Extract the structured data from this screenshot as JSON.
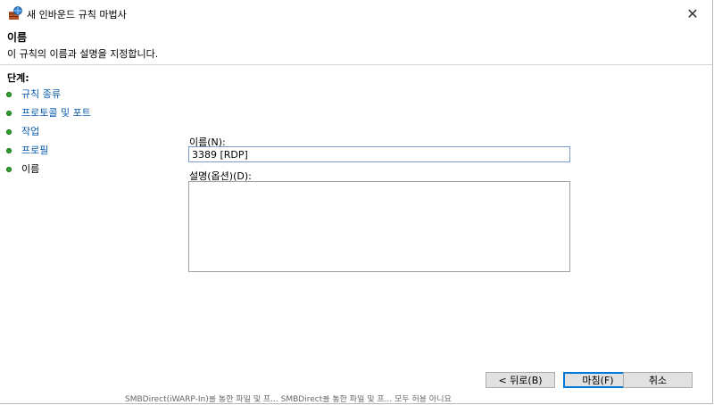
{
  "window": {
    "title": "새 인바운드 규칙 마법사",
    "close_symbol": "✕"
  },
  "header": {
    "title": "이름",
    "description": "이 규칙의 이름과 설명을 지정합니다."
  },
  "steps": {
    "title": "단계:",
    "items": [
      {
        "label": "규칙 종류"
      },
      {
        "label": "프로토콜 및 포트"
      },
      {
        "label": "작업"
      },
      {
        "label": "프로필"
      },
      {
        "label": "이름"
      }
    ]
  },
  "form": {
    "name_label": "이름(N):",
    "name_value": "3389 [RDP]",
    "description_label": "설명(옵션)(D):",
    "description_value": ""
  },
  "buttons": {
    "back": "< 뒤로(B)",
    "finish": "마침(F)",
    "cancel": "취소"
  },
  "background_window": {
    "text": "SMBDirect(iWARP-In)를 통한 파일 및 프...   SMBDirect를 통한 파일 및 프...   모두   허용   아니요"
  },
  "colors": {
    "step_link": "#0b5cad",
    "step_dot": "#2f9e2f",
    "focus_border": "#0078d7"
  },
  "icons": {
    "app": "firewall-wizard-icon",
    "close": "close-icon",
    "step": "green-dot-icon"
  }
}
